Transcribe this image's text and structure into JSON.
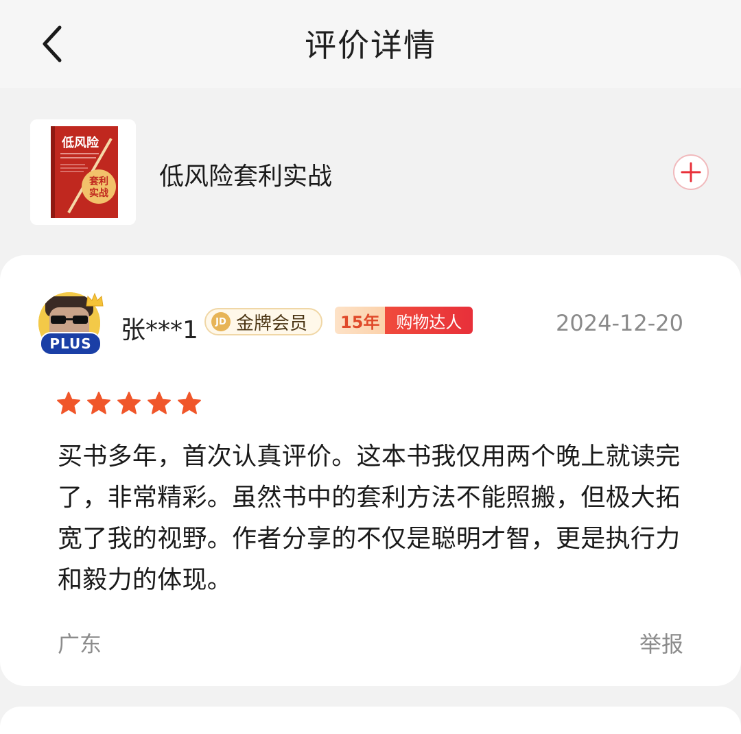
{
  "header": {
    "title": "评价详情",
    "back_icon": "chevron-left-icon"
  },
  "product": {
    "name": "低风险套利实战",
    "cover": {
      "title_line": "低风险",
      "circle_text_top": "套利",
      "circle_text_bottom": "实战"
    },
    "add_icon": "plus-circle-icon"
  },
  "review": {
    "user": {
      "name": "张***1",
      "plus_label": "PLUS",
      "gold_member_label": "金牌会员",
      "jd_icon_text": "JD",
      "years_label": "15年",
      "shopper_label": "购物达人"
    },
    "date": "2024-12-20",
    "rating": 5,
    "text": "买书多年，首次认真评价。这本书我仅用两个晚上就读完了，非常精彩。虽然书中的套利方法不能照搬，但极大拓宽了我的视野。作者分享的不仅是聪明才智，更是执行力和毅力的体现。",
    "location": "广东",
    "report_label": "举报"
  },
  "colors": {
    "star": "#f0562a",
    "accent_red": "#e8303a",
    "plus_blue": "#1a3fa6"
  }
}
